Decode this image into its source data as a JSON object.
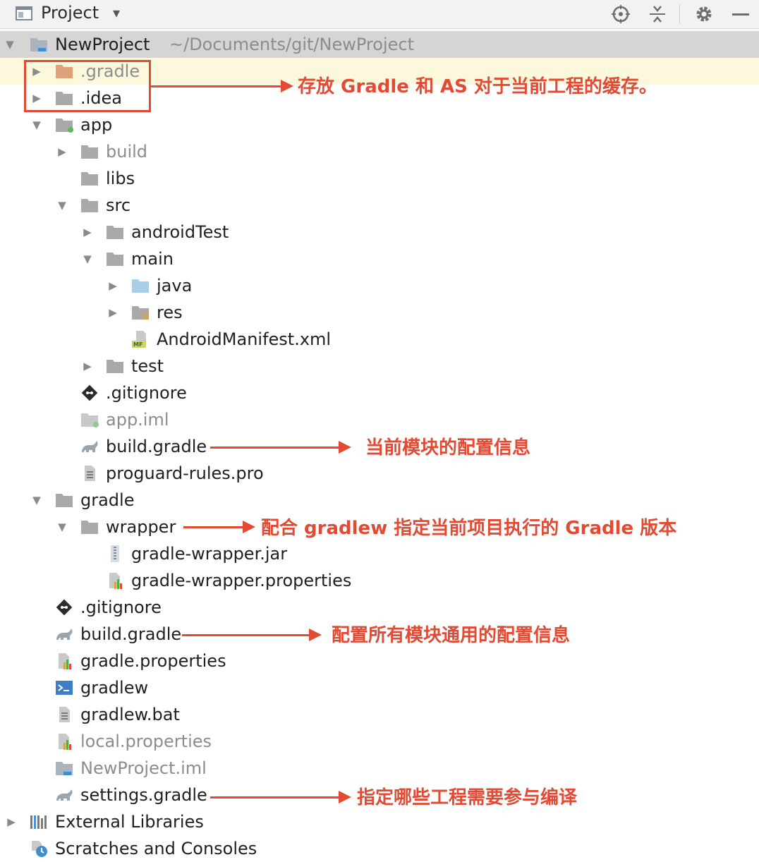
{
  "header": {
    "title": "Project",
    "icons": [
      "project-view-icon",
      "dropdown-caret-icon",
      "locate-icon",
      "collapse-all-icon",
      "settings-icon",
      "minimize-icon"
    ]
  },
  "tree": {
    "root_label": "NewProject",
    "root_path": "~/Documents/git/NewProject",
    "gradle_dir": ".gradle",
    "idea_dir": ".idea",
    "app": "app",
    "build": "build",
    "libs": "libs",
    "src": "src",
    "android_test": "androidTest",
    "main": "main",
    "java": "java",
    "res": "res",
    "manifest": "AndroidManifest.xml",
    "test": "test",
    "app_gitignore": ".gitignore",
    "app_iml": "app.iml",
    "app_build_gradle": "build.gradle",
    "proguard": "proguard-rules.pro",
    "gradle": "gradle",
    "wrapper": "wrapper",
    "wrapper_jar": "gradle-wrapper.jar",
    "wrapper_props": "gradle-wrapper.properties",
    "gitignore": ".gitignore",
    "build_gradle": "build.gradle",
    "gradle_props": "gradle.properties",
    "gradlew": "gradlew",
    "gradlew_bat": "gradlew.bat",
    "local_props": "local.properties",
    "project_iml": "NewProject.iml",
    "settings_gradle": "settings.gradle",
    "external_libs": "External Libraries",
    "scratches": "Scratches and Consoles"
  },
  "annotations": {
    "cache": "存放 Gradle 和 AS 对于当前工程的缓存。",
    "module_config": "当前模块的配置信息",
    "wrapper": "配合 gradlew 指定当前项目执行的 Gradle 版本",
    "all_modules": "配置所有模块通用的配置信息",
    "settings": "指定哪些工程需要参与编译"
  },
  "colors": {
    "annotation": "#e24a33",
    "root_bg": "#d5d5d5",
    "highlight_bg": "#fbf8dc",
    "folder": "#a9a9a9",
    "folder_orange": "#e0a07a",
    "folder_blue": "#a9cfe8"
  }
}
